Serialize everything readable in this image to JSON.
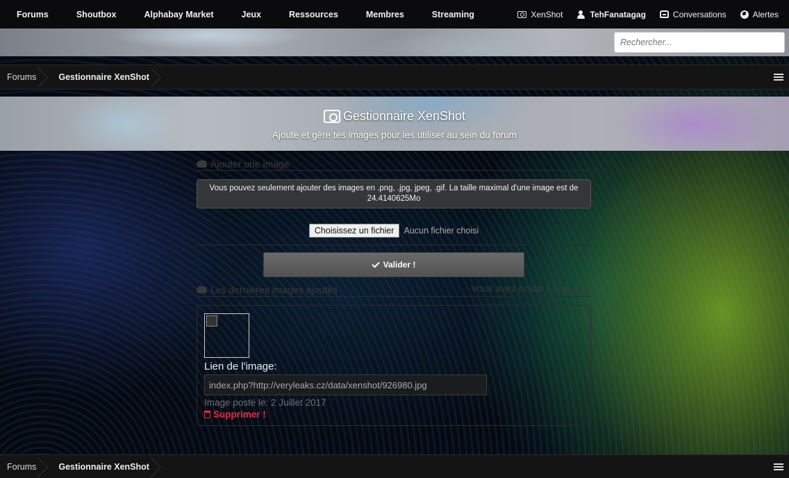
{
  "nav": {
    "links": [
      "Forums",
      "Shoutbox",
      "Alphabay Market",
      "Jeux",
      "Ressources",
      "Membres",
      "Streaming"
    ],
    "xenshot": "XenShot",
    "user": "TehFanatagag",
    "conversations": "Conversations",
    "alerts": "Alertes"
  },
  "search": {
    "placeholder": "Rechercher..."
  },
  "breadcrumb": {
    "root": "Forums",
    "current": "Gestionnaire XenShot"
  },
  "banner": {
    "title": "Gestionnaire XenShot",
    "subtitle": "Ajoute et gère tes images pour les utiliser au sein du forum"
  },
  "upload": {
    "section_title": "Ajouter une image",
    "notice": "Vous pouvez seulement ajouter des images en .png, .jpg, jpeg, .gif. La taille maximal d'une image est de 24.4140625Mo",
    "file_button": "Choisissez un fichier",
    "no_file": "Aucun fichier choisi",
    "submit": "Valider !"
  },
  "recent": {
    "section_title": "Les dernières images ajoutés",
    "count_text": "Vous avez posté 1 image(s)",
    "link_label": "Lien de l'image:",
    "link_value": "index.php?http://veryleaks.cz/data/xenshot/926980.jpg",
    "posted": "Image posté le: 2 Juillet 2017",
    "delete": "Supprimer !"
  }
}
